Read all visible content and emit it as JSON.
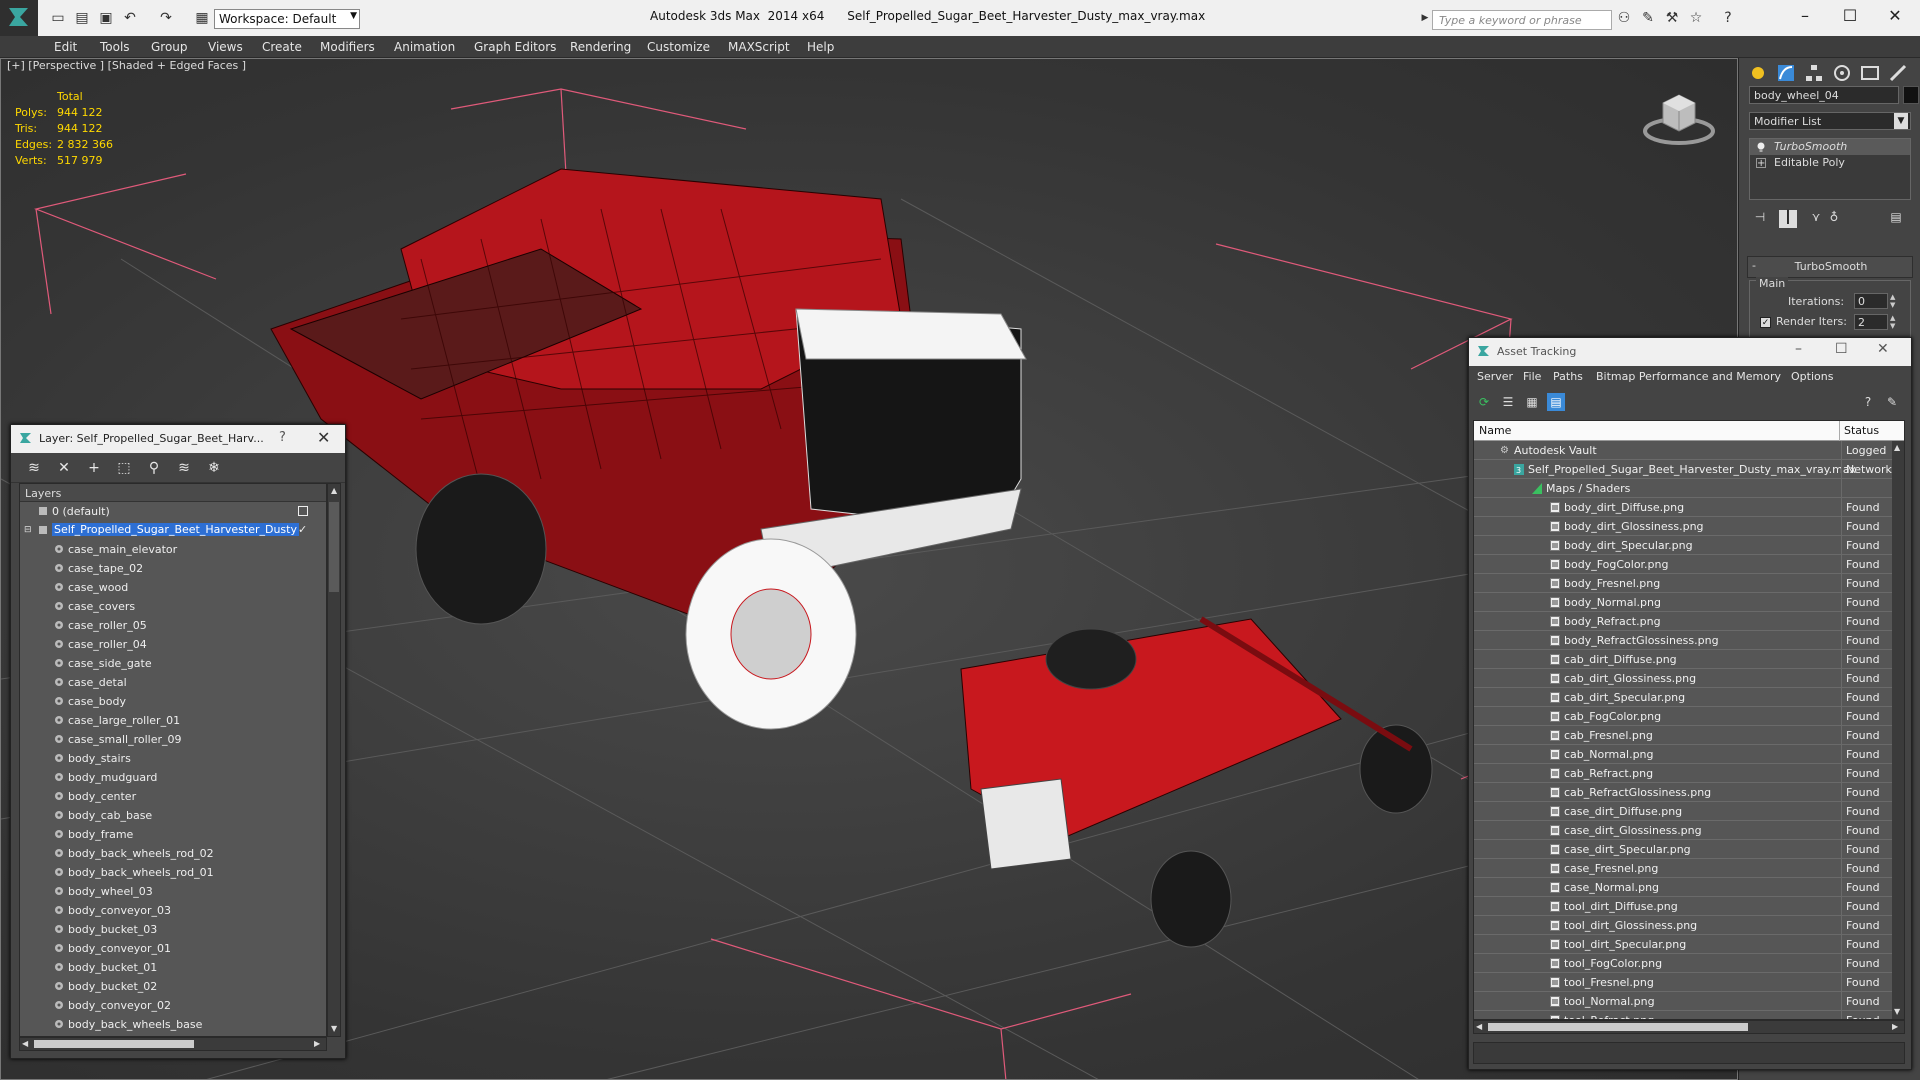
{
  "titlebar": {
    "workspace": "Workspace: Default",
    "title": "Autodesk 3ds Max  2014 x64      Self_Propelled_Sugar_Beet_Harvester_Dusty_max_vray.max",
    "search_placeholder": "Type a keyword or phrase"
  },
  "menu": [
    "Edit",
    "Tools",
    "Group",
    "Views",
    "Create",
    "Modifiers",
    "Animation",
    "Graph Editors",
    "Rendering",
    "Customize",
    "MAXScript",
    "Help"
  ],
  "viewport": {
    "label": "[+] [Perspective ] [Shaded + Edged Faces ]",
    "stats": {
      "header": "Total",
      "rows": [
        {
          "label": "Polys:",
          "value": "944 122"
        },
        {
          "label": "Tris:",
          "value": "944 122"
        },
        {
          "label": "Edges:",
          "value": "2 832 366"
        },
        {
          "label": "Verts:",
          "value": "517 979"
        }
      ]
    }
  },
  "command_panel": {
    "object_name": "body_wheel_04",
    "modifier_list": "Modifier List",
    "stack": [
      "TurboSmooth",
      "Editable Poly"
    ],
    "rollout_title": "TurboSmooth",
    "group": "Main",
    "iterations_label": "Iterations:",
    "iterations_value": "0",
    "render_iters_label": "Render Iters:",
    "render_iters_value": "2"
  },
  "layer_dialog": {
    "title": "Layer: Self_Propelled_Sugar_Beet_Harv...",
    "help": "?",
    "header": "Layers",
    "default_layer": "0 (default)",
    "selected_layer": "Self_Propelled_Sugar_Beet_Harvester_Dusty",
    "items": [
      "case_main_elevator",
      "case_tape_02",
      "case_wood",
      "case_covers",
      "case_roller_05",
      "case_roller_04",
      "case_side_gate",
      "case_detal",
      "case_body",
      "case_large_roller_01",
      "case_small_roller_09",
      "body_stairs",
      "body_mudguard",
      "body_center",
      "body_cab_base",
      "body_frame",
      "body_back_wheels_rod_02",
      "body_back_wheels_rod_01",
      "body_wheel_03",
      "body_conveyor_03",
      "body_bucket_03",
      "body_conveyor_01",
      "body_bucket_01",
      "body_bucket_02",
      "body_conveyor_02",
      "body_back_wheels_base"
    ]
  },
  "asset_dialog": {
    "title": "Asset Tracking",
    "menu": [
      "Server",
      "File",
      "Paths",
      "Bitmap Performance and Memory",
      "Options"
    ],
    "col_name": "Name",
    "col_status": "Status",
    "vault": {
      "name": "Autodesk Vault",
      "status": "Logged"
    },
    "file": {
      "name": "Self_Propelled_Sugar_Beet_Harvester_Dusty_max_vray.max",
      "status": "Network"
    },
    "maps_group": "Maps / Shaders",
    "maps": [
      "body_dirt_Diffuse.png",
      "body_dirt_Glossiness.png",
      "body_dirt_Specular.png",
      "body_FogColor.png",
      "body_Fresnel.png",
      "body_Normal.png",
      "body_Refract.png",
      "body_RefractGlossiness.png",
      "cab_dirt_Diffuse.png",
      "cab_dirt_Glossiness.png",
      "cab_dirt_Specular.png",
      "cab_FogColor.png",
      "cab_Fresnel.png",
      "cab_Normal.png",
      "cab_Refract.png",
      "cab_RefractGlossiness.png",
      "case_dirt_Diffuse.png",
      "case_dirt_Glossiness.png",
      "case_dirt_Specular.png",
      "case_Fresnel.png",
      "case_Normal.png",
      "tool_dirt_Diffuse.png",
      "tool_dirt_Glossiness.png",
      "tool_dirt_Specular.png",
      "tool_FogColor.png",
      "tool_Fresnel.png",
      "tool_Normal.png",
      "tool_Refract.png"
    ],
    "found_label": "Found"
  },
  "colors": {
    "accent": "#2d6fd4",
    "stats": "#ffd800",
    "model": "#c8181e",
    "bounds": "#e05a7a"
  }
}
